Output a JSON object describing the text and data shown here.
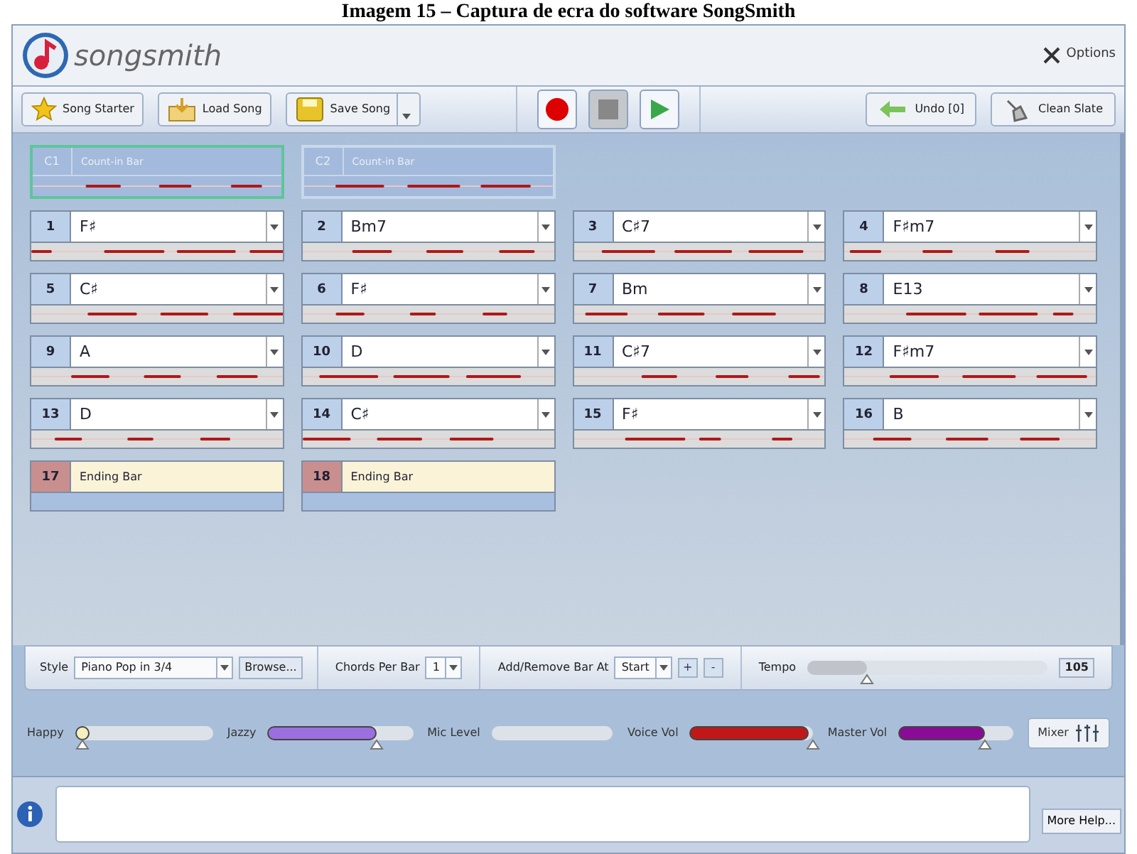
{
  "caption": "Imagem 15 – Captura de ecra do software SongSmith",
  "header": {
    "logo_text": "songsmith",
    "options": "Options"
  },
  "toolbar": {
    "left": [
      {
        "label": "Song Starter",
        "kind": "star"
      },
      {
        "label": "Load Song",
        "kind": "load"
      },
      {
        "label": "Save Song",
        "kind": "save"
      }
    ],
    "transport": [
      {
        "kind": "record",
        "disabled": false
      },
      {
        "kind": "stop",
        "disabled": true
      },
      {
        "kind": "play",
        "disabled": false
      }
    ],
    "right": [
      {
        "label": "Undo [0]",
        "kind": "undo"
      },
      {
        "label": "Clean Slate",
        "kind": "clean"
      }
    ]
  },
  "count_in": [
    {
      "number": "C1",
      "label": "Count-in Bar",
      "selected": true
    },
    {
      "number": "C2",
      "label": "Count-in Bar",
      "selected": false
    }
  ],
  "bars": [
    {
      "number": "1",
      "chord": "F♯",
      "kind": "chord"
    },
    {
      "number": "2",
      "chord": "Bm7",
      "kind": "chord"
    },
    {
      "number": "3",
      "chord": "C♯7",
      "kind": "chord"
    },
    {
      "number": "4",
      "chord": "F♯m7",
      "kind": "chord"
    },
    {
      "number": "5",
      "chord": "C♯",
      "kind": "chord"
    },
    {
      "number": "6",
      "chord": "F♯",
      "kind": "chord"
    },
    {
      "number": "7",
      "chord": "Bm",
      "kind": "chord"
    },
    {
      "number": "8",
      "chord": "E13",
      "kind": "chord"
    },
    {
      "number": "9",
      "chord": "A",
      "kind": "chord"
    },
    {
      "number": "10",
      "chord": "D",
      "kind": "chord"
    },
    {
      "number": "11",
      "chord": "C♯7",
      "kind": "chord"
    },
    {
      "number": "12",
      "chord": "F♯m7",
      "kind": "chord"
    },
    {
      "number": "13",
      "chord": "D",
      "kind": "chord"
    },
    {
      "number": "14",
      "chord": "C♯",
      "kind": "chord"
    },
    {
      "number": "15",
      "chord": "F♯",
      "kind": "chord"
    },
    {
      "number": "16",
      "chord": "B",
      "kind": "chord"
    },
    {
      "number": "17",
      "chord": "Ending Bar",
      "kind": "ending"
    },
    {
      "number": "18",
      "chord": "Ending Bar",
      "kind": "ending"
    }
  ],
  "controls": {
    "style_label": "Style",
    "style_value": "Piano Pop in 3/4",
    "browse": "Browse...",
    "chords_label": "Chords Per Bar",
    "chords_value": "1",
    "addremove_label": "Add/Remove Bar At",
    "addremove_value": "Start",
    "plus": "+",
    "minus": "-",
    "tempo_label": "Tempo",
    "tempo": {
      "level": 0.25
    },
    "tempo_value": "105"
  },
  "sliders": [
    {
      "label": "Happy",
      "level": 0.05,
      "color": "#f5f0c0"
    },
    {
      "label": "Jazzy",
      "level": 0.75,
      "color": "#9a6fe0"
    },
    {
      "label": "Mic Level"
    },
    {
      "label": "Voice Vol",
      "level": 1,
      "color": "#c01818"
    },
    {
      "label": "Master Vol",
      "level": 0.75,
      "color": "#8a0c96"
    }
  ],
  "mixer": "Mixer",
  "more_help": "More Help..."
}
